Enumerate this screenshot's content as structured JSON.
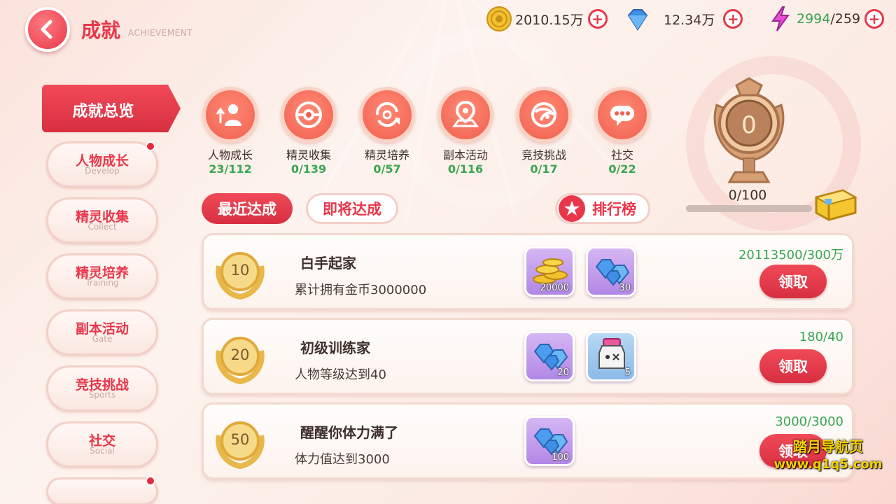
{
  "header": {
    "title": "成就",
    "subtitle": "ACHIEVEMENT",
    "resources": {
      "gold": "2010.15万",
      "diamond": "12.34万",
      "stamina_current": "2994",
      "stamina_max": "/259"
    }
  },
  "sidebar": {
    "active": "成就总览",
    "items": [
      {
        "zh": "人物成长",
        "en": "Develop"
      },
      {
        "zh": "精灵收集",
        "en": "Collect"
      },
      {
        "zh": "精灵培养",
        "en": "Training"
      },
      {
        "zh": "副本活动",
        "en": "Gate"
      },
      {
        "zh": "竞技挑战",
        "en": "Sports"
      },
      {
        "zh": "社交",
        "en": "Social"
      }
    ]
  },
  "categories": [
    {
      "name": "人物成长",
      "count": "23/112",
      "icon": "person-growth-icon"
    },
    {
      "name": "精灵收集",
      "count": "0/139",
      "icon": "pokeball-icon"
    },
    {
      "name": "精灵培养",
      "count": "0/57",
      "icon": "training-cycle-icon"
    },
    {
      "name": "副本活动",
      "count": "0/116",
      "icon": "map-pin-icon"
    },
    {
      "name": "竞技挑战",
      "count": "0/17",
      "icon": "battle-icon"
    },
    {
      "name": "社交",
      "count": "0/22",
      "icon": "chat-bubble-icon"
    }
  ],
  "trophy": {
    "level": "0",
    "progress_text": "0/100",
    "progress_fraction": 0.0
  },
  "tabs": {
    "recent": "最近达成",
    "upcoming": "即将达成",
    "ranking": "排行榜"
  },
  "achievements": [
    {
      "badge": "10",
      "title": "白手起家",
      "desc": "累计拥有金币3000000",
      "progress": "20113500/300万",
      "claim": "领取",
      "rewards": [
        {
          "type": "gold-coins-icon",
          "qty": "20000",
          "style": "purple"
        },
        {
          "type": "diamonds-icon",
          "qty": "30",
          "style": "purple"
        }
      ]
    },
    {
      "badge": "20",
      "title": "初级训练家",
      "desc": "人物等级达到40",
      "progress": "180/40",
      "claim": "领取",
      "rewards": [
        {
          "type": "diamonds-icon",
          "qty": "20",
          "style": "purple"
        },
        {
          "type": "potion-jar-icon",
          "qty": "5",
          "style": "blue"
        }
      ]
    },
    {
      "badge": "50",
      "title": "醒醒你体力满了",
      "desc": "体力值达到3000",
      "progress": "3000/3000",
      "claim": "领取",
      "rewards": [
        {
          "type": "diamonds-icon",
          "qty": "100",
          "style": "purple"
        }
      ]
    }
  ],
  "watermark": {
    "line1": "踏月导航页",
    "line2": "www.q1q5.com"
  },
  "colors": {
    "accent": "#e8374a",
    "count_green": "#3aa552",
    "background": "#fdf3ee"
  }
}
